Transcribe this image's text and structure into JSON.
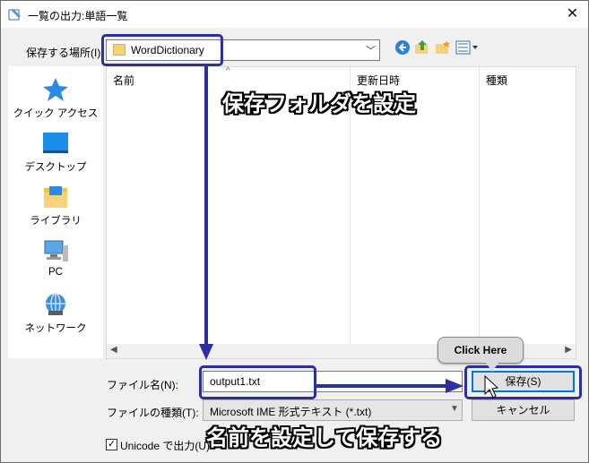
{
  "window": {
    "title": "一覧の出力:単語一覧",
    "close_glyph": "✕"
  },
  "location": {
    "label": "保存する場所(I):",
    "value": "WordDictionary"
  },
  "places": [
    {
      "label": "クイック アクセス",
      "icon": "star-icon"
    },
    {
      "label": "デスクトップ",
      "icon": "desktop-icon"
    },
    {
      "label": "ライブラリ",
      "icon": "library-icon"
    },
    {
      "label": "PC",
      "icon": "pc-icon"
    },
    {
      "label": "ネットワーク",
      "icon": "network-icon"
    }
  ],
  "file_list": {
    "columns": [
      "名前",
      "更新日時",
      "種類"
    ]
  },
  "filename": {
    "label": "ファイル名(N):",
    "value": "output1.txt"
  },
  "filetype": {
    "label": "ファイルの種類(T):",
    "value": "Microsoft IME 形式テキスト (*.txt)"
  },
  "buttons": {
    "save": "保存(S)",
    "cancel": "キャンセル"
  },
  "unicode": {
    "label": "Unicode で出力(U)",
    "checked": true
  },
  "annotations": {
    "folder_hint": "保存フォルダを設定",
    "save_hint": "名前を設定して保存する",
    "click_here": "Click Here"
  },
  "colors": {
    "annotation": "#2d2f9c",
    "accent": "#0078d7"
  }
}
